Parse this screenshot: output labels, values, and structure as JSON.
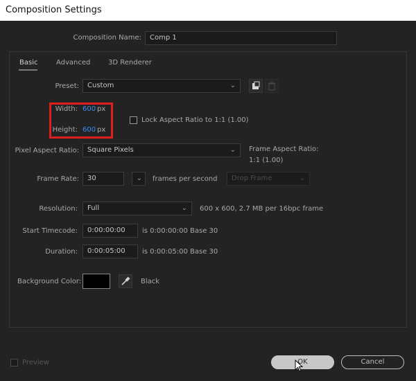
{
  "window": {
    "title": "Composition Settings"
  },
  "comp_name": {
    "label": "Composition Name:",
    "value": "Comp 1"
  },
  "tabs": [
    {
      "label": "Basic",
      "active": true
    },
    {
      "label": "Advanced"
    },
    {
      "label": "3D Renderer"
    }
  ],
  "preset": {
    "label": "Preset:",
    "value": "Custom"
  },
  "width": {
    "label": "Width:",
    "value": "600",
    "unit": "px"
  },
  "height": {
    "label": "Height:",
    "value": "600",
    "unit": "px"
  },
  "lock_aspect": {
    "label": "Lock Aspect Ratio to 1:1 (1.00)",
    "checked": false
  },
  "pixel_aspect": {
    "label": "Pixel Aspect Ratio:",
    "value": "Square Pixels"
  },
  "frame_aspect": {
    "label": "Frame Aspect Ratio:",
    "value": "1:1 (1.00)"
  },
  "frame_rate": {
    "label": "Frame Rate:",
    "value": "30",
    "unit": "frames per second",
    "drop_frame": "Drop Frame"
  },
  "resolution": {
    "label": "Resolution:",
    "value": "Full",
    "info": "600 x 600, 2.7 MB per 16bpc frame"
  },
  "start_timecode": {
    "label": "Start Timecode:",
    "value": "0:00:00:00",
    "info": "is 0:00:00:00  Base 30"
  },
  "duration": {
    "label": "Duration:",
    "value": "0:00:05:00",
    "info": "is 0:00:05:00  Base 30"
  },
  "background": {
    "label": "Background Color:",
    "color_name": "Black",
    "color": "#000000"
  },
  "footer": {
    "preview": "Preview",
    "ok": "OK",
    "cancel": "Cancel"
  },
  "colors": {
    "highlight": "#e11d1d",
    "value_blue": "#3d8ef0"
  }
}
